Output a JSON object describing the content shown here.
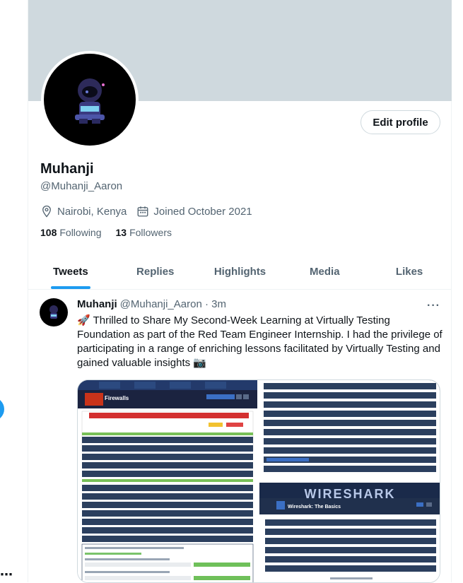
{
  "profile": {
    "name": "Muhanji",
    "handle": "@Muhanji_Aaron",
    "location": "Nairobi, Kenya",
    "joined": "Joined October 2021",
    "following_count": "108",
    "following_label": "Following",
    "followers_count": "13",
    "followers_label": "Followers",
    "edit_label": "Edit profile"
  },
  "tabs": [
    {
      "label": "Tweets"
    },
    {
      "label": "Replies"
    },
    {
      "label": "Highlights"
    },
    {
      "label": "Media"
    },
    {
      "label": "Likes"
    }
  ],
  "tweet": {
    "name": "Muhanji",
    "handle_time": "@Muhanji_Aaron · 3m",
    "text": "🚀 Thrilled to Share My Second-Week Learning at Virtually Testing Foundation as part of the Red Team Engineer Internship. I had the privilege of participating in a range of enriching lessons facilitated by Virtually Testing and gained valuable insights 📷",
    "media_left_title": "Firewalls",
    "media_right_title": "Wireshark: The Basics",
    "media_right_banner": "WIRESHARK"
  },
  "icons": {
    "location": "location-pin-icon",
    "calendar": "calendar-icon",
    "more": "more-icon"
  },
  "colors": {
    "accent": "#1d9bf0",
    "secondary_text": "#536471",
    "banner": "#cfd9de"
  }
}
